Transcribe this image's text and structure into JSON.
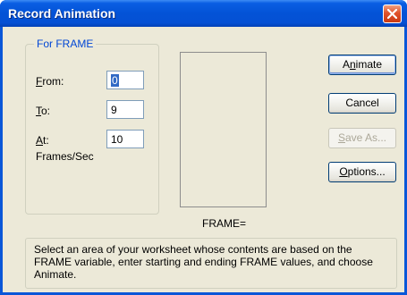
{
  "window": {
    "title": "Record Animation"
  },
  "group": {
    "label": "For FRAME",
    "from": {
      "label_key": "F",
      "label_rest": "rom:",
      "value": "0"
    },
    "to": {
      "label_key": "T",
      "label_rest": "o:",
      "value": "9"
    },
    "at": {
      "label_key": "A",
      "label_rest": "t:",
      "value": "10"
    },
    "rate_label": "Frames/Sec"
  },
  "preview": {
    "caption": "FRAME="
  },
  "buttons": {
    "animate": {
      "pre": "A",
      "key": "n",
      "post": "imate"
    },
    "cancel": {
      "label": "Cancel"
    },
    "save_as": {
      "key": "S",
      "post": "ave As..."
    },
    "options": {
      "key": "O",
      "post": "ptions..."
    }
  },
  "hint": "Select an area of your worksheet whose contents are based on the FRAME variable, enter starting and ending FRAME values, and choose Animate.",
  "colors": {
    "titlebar": "#0353d6",
    "close": "#e0522b",
    "group_label": "#0046d5",
    "dialog_bg": "#ece9d8"
  }
}
